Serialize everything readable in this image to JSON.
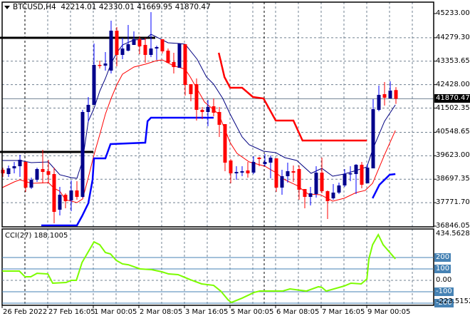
{
  "header": {
    "symbol": "BTCUSD,H4",
    "ohlc": "42214.01 42330.01 41669.95 41870.47"
  },
  "colors": {
    "bull_body": "#00008b",
    "bull_wick": "#0000ff",
    "bear": "#ff0000",
    "cci_line": "#7cfc00",
    "level_line": "#4682b4",
    "grid": "#708090"
  },
  "chart_data": [
    {
      "type": "candlestick",
      "title": "BTCUSD,H4",
      "ylim": [
        36846.05,
        45233.0
      ],
      "yticks": [
        "45233.00",
        "44279.30",
        "43353.65",
        "42428.00",
        "41502.35",
        "40548.65",
        "39623.00",
        "38697.35",
        "37771.70",
        "36846.05"
      ],
      "ytick_values": [
        45233.0,
        44279.3,
        43353.65,
        42428.0,
        41502.35,
        40548.65,
        39623.0,
        38697.35,
        37771.7,
        36846.05
      ],
      "current_price": 41870.47,
      "current_price_label": "41870.47",
      "xticks": [
        "26 Feb 2022",
        "27 Feb 16:05",
        "1 Mar 00:05",
        "2 Mar 08:05",
        "3 Mar 16:05",
        "5 Mar 00:05",
        "6 Mar 08:05",
        "7 Mar 16:05",
        "9 Mar 00:05"
      ],
      "candles_ohlc": [
        [
          39070,
          39154,
          38788,
          38929
        ],
        [
          38901,
          39239,
          38788,
          39126
        ],
        [
          39126,
          39379,
          38929,
          39210
        ],
        [
          39210,
          39661,
          38788,
          39464
        ],
        [
          39379,
          39407,
          38197,
          38366
        ],
        [
          38366,
          38760,
          38310,
          38676
        ],
        [
          38676,
          39154,
          38591,
          39098
        ],
        [
          39098,
          39858,
          38535,
          38985
        ],
        [
          39013,
          39464,
          38535,
          38873
        ],
        [
          38901,
          39154,
          36959,
          37409
        ],
        [
          37494,
          38394,
          37269,
          38085
        ],
        [
          38085,
          38141,
          37550,
          37831
        ],
        [
          37860,
          38648,
          37437,
          38254
        ],
        [
          38254,
          38619,
          37888,
          38000
        ],
        [
          38000,
          41434,
          37972,
          41349
        ],
        [
          41349,
          41940,
          40955,
          41631
        ],
        [
          41631,
          44051,
          41631,
          43207
        ],
        [
          43207,
          43376,
          43066,
          43179
        ],
        [
          43179,
          43713,
          42982,
          43263
        ],
        [
          42982,
          44952,
          42869,
          44558
        ],
        [
          44558,
          44699,
          43151,
          43601
        ],
        [
          43601,
          44276,
          43432,
          43854
        ],
        [
          43770,
          44783,
          43742,
          44023
        ],
        [
          43995,
          44530,
          43995,
          44220
        ],
        [
          44220,
          44333,
          43629,
          43939
        ],
        [
          43995,
          44276,
          43291,
          43601
        ],
        [
          43601,
          45290,
          43516,
          43854
        ],
        [
          43854,
          43967,
          43404,
          43910
        ],
        [
          44220,
          44220,
          43657,
          43742
        ],
        [
          43770,
          43854,
          43291,
          43291
        ],
        [
          43319,
          43685,
          42869,
          43122
        ],
        [
          43094,
          44051,
          43094,
          44051
        ],
        [
          44023,
          44023,
          41997,
          42419
        ],
        [
          42447,
          42447,
          41772,
          42053
        ],
        [
          42447,
          42672,
          41012,
          41434
        ],
        [
          41434,
          41546,
          41068,
          41349
        ],
        [
          41349,
          41828,
          40787,
          41546
        ],
        [
          41575,
          41884,
          41181,
          41321
        ],
        [
          41349,
          41546,
          40364,
          40843
        ],
        [
          40871,
          40871,
          39013,
          39351
        ],
        [
          39436,
          39492,
          38535,
          38929
        ],
        [
          38929,
          39210,
          38676,
          38985
        ],
        [
          38957,
          39210,
          38816,
          39013
        ],
        [
          39042,
          39379,
          38760,
          38929
        ],
        [
          38957,
          39604,
          38901,
          39379
        ],
        [
          39548,
          39576,
          39210,
          39492
        ],
        [
          39295,
          39689,
          39210,
          39379
        ],
        [
          39351,
          39633,
          38732,
          39548
        ],
        [
          39520,
          39520,
          38197,
          38366
        ],
        [
          38366,
          39070,
          38085,
          38816
        ],
        [
          38816,
          39351,
          38563,
          39013
        ],
        [
          39013,
          39239,
          38591,
          38957
        ],
        [
          39098,
          39239,
          37888,
          38282
        ],
        [
          38310,
          38310,
          37550,
          38000
        ],
        [
          38000,
          38394,
          37663,
          38141
        ],
        [
          38113,
          39210,
          37972,
          38957
        ],
        [
          38957,
          39548,
          38141,
          38225
        ],
        [
          38225,
          38254,
          37128,
          37831
        ],
        [
          37944,
          38507,
          37888,
          38169
        ],
        [
          38169,
          38563,
          38113,
          38451
        ],
        [
          38451,
          39098,
          38394,
          38901
        ],
        [
          38901,
          39210,
          38619,
          38929
        ],
        [
          38901,
          39295,
          38113,
          39267
        ],
        [
          39267,
          39379,
          38338,
          38479
        ],
        [
          38535,
          39295,
          38535,
          39154
        ],
        [
          39126,
          41856,
          39126,
          41462
        ],
        [
          41434,
          42391,
          41378,
          42025
        ],
        [
          42053,
          42531,
          41603,
          41912
        ],
        [
          41884,
          42560,
          41884,
          42194
        ],
        [
          42214.01,
          42330.01,
          41669.95,
          41870.47
        ]
      ],
      "series": [
        {
          "name": "upper-band",
          "style": "thin",
          "color": "#000080",
          "points": [
            [
              -0.1,
              39436
            ],
            [
              3,
              39436
            ],
            [
              5,
              39351
            ],
            [
              8,
              39379
            ],
            [
              9,
              39126
            ],
            [
              10,
              38873
            ],
            [
              12,
              38760
            ],
            [
              13,
              38732
            ],
            [
              14,
              39436
            ],
            [
              15,
              40984
            ],
            [
              16,
              41490
            ],
            [
              17,
              42166
            ],
            [
              18,
              42672
            ],
            [
              19,
              43263
            ],
            [
              20,
              43685
            ],
            [
              21,
              43995
            ],
            [
              23,
              44192
            ],
            [
              25,
              44220
            ],
            [
              26,
              44417
            ],
            [
              27,
              44305
            ],
            [
              29,
              44080
            ],
            [
              31,
              44051
            ],
            [
              32,
              44023
            ],
            [
              34.1,
              43432
            ],
            [
              35.75,
              42728
            ],
            [
              37,
              42447
            ],
            [
              38.6,
              41884
            ],
            [
              39.9,
              41265
            ],
            [
              42,
              40364
            ],
            [
              43.25,
              40054
            ],
            [
              45.75,
              39801
            ],
            [
              47.9,
              39745
            ],
            [
              49.5,
              39548
            ],
            [
              51.6,
              39436
            ],
            [
              54.1,
              38929
            ],
            [
              56,
              39126
            ],
            [
              57.9,
              38816
            ],
            [
              59.9,
              38901
            ],
            [
              62,
              39042
            ],
            [
              63.9,
              39182
            ],
            [
              64.9,
              39858
            ],
            [
              67,
              40984
            ],
            [
              68.9,
              41631
            ]
          ]
        },
        {
          "name": "lower-band",
          "style": "thin",
          "color": "#ff0000",
          "points": [
            [
              -0.1,
              38366
            ],
            [
              2,
              38591
            ],
            [
              3,
              38676
            ],
            [
              5,
              38535
            ],
            [
              8,
              38563
            ],
            [
              9,
              38338
            ],
            [
              10,
              38225
            ],
            [
              11,
              37888
            ],
            [
              13,
              37775
            ],
            [
              14,
              37916
            ],
            [
              15,
              38760
            ],
            [
              16,
              39661
            ],
            [
              17,
              40449
            ],
            [
              18,
              41265
            ],
            [
              19,
              41884
            ],
            [
              20,
              42419
            ],
            [
              21,
              42841
            ],
            [
              23,
              43122
            ],
            [
              25,
              43235
            ],
            [
              27,
              43376
            ],
            [
              28,
              43404
            ],
            [
              29.9,
              43179
            ],
            [
              32,
              43038
            ],
            [
              32.9,
              42728
            ],
            [
              35.4,
              41743
            ],
            [
              37.9,
              41265
            ],
            [
              39.9,
              40139
            ],
            [
              41.1,
              39717
            ],
            [
              43.25,
              39379
            ],
            [
              46,
              39210
            ],
            [
              47.9,
              38957
            ],
            [
              49.5,
              38676
            ],
            [
              51.6,
              38451
            ],
            [
              53.6,
              38113
            ],
            [
              55.75,
              38085
            ],
            [
              57.9,
              37831
            ],
            [
              59.9,
              37944
            ],
            [
              62,
              38169
            ],
            [
              63.6,
              38254
            ],
            [
              64.9,
              38535
            ],
            [
              67,
              39661
            ],
            [
              68.9,
              40618
            ]
          ]
        },
        {
          "name": "support-stop",
          "style": "thick",
          "color": "#0000ff",
          "points": [
            [
              6.75,
              36874
            ],
            [
              13,
              36874
            ],
            [
              13.9,
              37240
            ],
            [
              15,
              37747
            ],
            [
              15.75,
              38676
            ],
            [
              16,
              39520
            ],
            [
              18,
              39520
            ],
            [
              18.9,
              40083
            ],
            [
              25,
              40139
            ],
            [
              25.4,
              40984
            ],
            [
              26,
              41124
            ],
            [
              37,
              41124
            ]
          ]
        },
        {
          "name": "support-stop-2",
          "style": "thick",
          "color": "#0000ff",
          "points": [
            [
              64.9,
              37944
            ],
            [
              66.1,
              38479
            ],
            [
              67.9,
              38873
            ],
            [
              68.9,
              38901
            ]
          ]
        },
        {
          "name": "resistance-stop",
          "style": "thick",
          "color": "#ff0000",
          "points": [
            [
              37.9,
              43685
            ],
            [
              38.9,
              42728
            ],
            [
              39.9,
              42306
            ],
            [
              42,
              42306
            ],
            [
              43.9,
              41940
            ],
            [
              45.75,
              41884
            ],
            [
              47.9,
              41012
            ],
            [
              51,
              41012
            ],
            [
              52.6,
              40224
            ],
            [
              63.9,
              40224
            ]
          ]
        },
        {
          "name": "level-high",
          "style": "level",
          "color": "#000000",
          "points": [
            [
              -0.5,
              44276
            ],
            [
              26.75,
              44276
            ]
          ]
        },
        {
          "name": "level-low",
          "style": "level",
          "color": "#000000",
          "points": [
            [
              -0.5,
              39773
            ],
            [
              15.9,
              39773
            ]
          ]
        }
      ]
    },
    {
      "type": "line",
      "title": "CCI(27) 188.1005",
      "ylim": [
        -223.5152,
        434.5628
      ],
      "max_label": "434.5628",
      "min_label": "-223.5152",
      "levels": [
        {
          "value": 200,
          "label": "200"
        },
        {
          "value": 100,
          "label": "100"
        },
        {
          "value": -100,
          "label": "-100"
        },
        {
          "value": -200,
          "label": "-200"
        }
      ],
      "zero_label": "0.00",
      "points": [
        [
          -0.1,
          81
        ],
        [
          2.9,
          81
        ],
        [
          3.9,
          31
        ],
        [
          4.9,
          31
        ],
        [
          6,
          62
        ],
        [
          7.9,
          56
        ],
        [
          8.75,
          -25
        ],
        [
          11.1,
          -19
        ],
        [
          12,
          0
        ],
        [
          12.9,
          0
        ],
        [
          13.9,
          156
        ],
        [
          16,
          337
        ],
        [
          17,
          312
        ],
        [
          18,
          244
        ],
        [
          18.9,
          231
        ],
        [
          19.9,
          175
        ],
        [
          21,
          144
        ],
        [
          22,
          137
        ],
        [
          24.1,
          100
        ],
        [
          26.1,
          94
        ],
        [
          27.9,
          75
        ],
        [
          29.1,
          56
        ],
        [
          30.75,
          50
        ],
        [
          32.9,
          6
        ],
        [
          34.9,
          -31
        ],
        [
          37,
          -44
        ],
        [
          38.25,
          -94
        ],
        [
          39.5,
          -169
        ],
        [
          40.1,
          -194
        ],
        [
          42,
          -156
        ],
        [
          44.1,
          -106
        ],
        [
          45.1,
          -94
        ],
        [
          49.1,
          -94
        ],
        [
          50.4,
          -75
        ],
        [
          53.25,
          -94
        ],
        [
          55.4,
          -56
        ],
        [
          56,
          -62
        ],
        [
          56.75,
          -94
        ],
        [
          59.9,
          -50
        ],
        [
          61.1,
          -25
        ],
        [
          62.9,
          -31
        ],
        [
          63.9,
          12
        ],
        [
          64.25,
          187
        ],
        [
          64.9,
          312
        ],
        [
          65.9,
          400
        ],
        [
          66.75,
          312
        ],
        [
          68.9,
          188
        ]
      ]
    }
  ]
}
